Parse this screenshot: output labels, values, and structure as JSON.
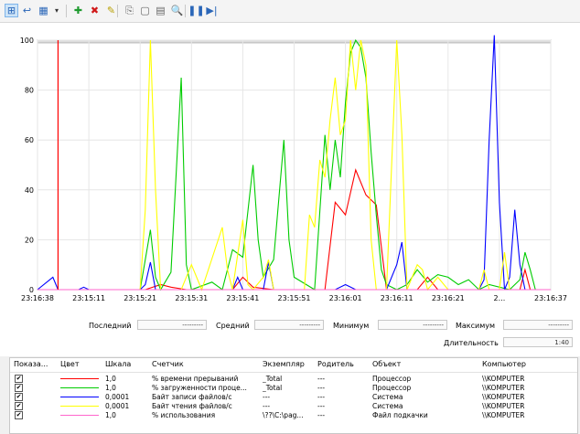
{
  "toolbar": {
    "buttons": [
      {
        "name": "view-graph-button",
        "glyph": "⊞"
      },
      {
        "name": "view-histogram-button",
        "glyph": "↩"
      },
      {
        "name": "change-graph-type-button",
        "glyph": "▦"
      },
      {
        "name": "graph-type-dropdown",
        "glyph": "▾"
      },
      {
        "name": "add-counter-button",
        "glyph": "✚"
      },
      {
        "name": "delete-counter-button",
        "glyph": "✖"
      },
      {
        "name": "highlight-button",
        "glyph": "✎"
      },
      {
        "name": "copy-properties-button",
        "glyph": "⎘"
      },
      {
        "name": "paste-counter-list-button",
        "glyph": "▢"
      },
      {
        "name": "properties-button",
        "glyph": "▤"
      },
      {
        "name": "zoom-button",
        "glyph": "🔍"
      },
      {
        "name": "freeze-display-button",
        "glyph": "❚❚"
      },
      {
        "name": "update-data-button",
        "glyph": "▶|"
      }
    ]
  },
  "chart_data": {
    "type": "line",
    "ylim": [
      0,
      100
    ],
    "yticks": [
      "0",
      "20",
      "40",
      "60",
      "80",
      "100"
    ],
    "xticks": [
      "23:16:38",
      "23:15:11",
      "23:15:21",
      "23:15:31",
      "23:15:41",
      "23:15:51",
      "23:16:01",
      "23:16:11",
      "23:16:21",
      "2...",
      "23:16:37"
    ],
    "current_time_marker": 4,
    "grid": true,
    "series": [
      {
        "color": "#ff0000",
        "points": [
          [
            0,
            0
          ],
          [
            4.5,
            0
          ],
          [
            5,
            0
          ],
          [
            21,
            0
          ],
          [
            24,
            2
          ],
          [
            26,
            1
          ],
          [
            29,
            0
          ],
          [
            38,
            0
          ],
          [
            40,
            5
          ],
          [
            42,
            1
          ],
          [
            46,
            0
          ],
          [
            56,
            0
          ],
          [
            58,
            35
          ],
          [
            60,
            30
          ],
          [
            62,
            48
          ],
          [
            64,
            38
          ],
          [
            66,
            34
          ],
          [
            68,
            0
          ],
          [
            72,
            0
          ],
          [
            74,
            0
          ],
          [
            76,
            5
          ],
          [
            78,
            0
          ],
          [
            94,
            0
          ],
          [
            95,
            8
          ],
          [
            96,
            0
          ],
          [
            100,
            0
          ]
        ]
      },
      {
        "color": "#00cc00",
        "points": [
          [
            0,
            0
          ],
          [
            20,
            0
          ],
          [
            22,
            24
          ],
          [
            23,
            5
          ],
          [
            24,
            0
          ],
          [
            26,
            7
          ],
          [
            28,
            85
          ],
          [
            29,
            10
          ],
          [
            30,
            0
          ],
          [
            34,
            3
          ],
          [
            36,
            0
          ],
          [
            38,
            16
          ],
          [
            40,
            13
          ],
          [
            42,
            50
          ],
          [
            43,
            20
          ],
          [
            44,
            5
          ],
          [
            46,
            12
          ],
          [
            48,
            60
          ],
          [
            49,
            20
          ],
          [
            50,
            5
          ],
          [
            54,
            0
          ],
          [
            56,
            62
          ],
          [
            57,
            40
          ],
          [
            58,
            60
          ],
          [
            59,
            45
          ],
          [
            60,
            75
          ],
          [
            61,
            95
          ],
          [
            62,
            100
          ],
          [
            63,
            97
          ],
          [
            64,
            85
          ],
          [
            65,
            55
          ],
          [
            66,
            30
          ],
          [
            67,
            8
          ],
          [
            68,
            2
          ],
          [
            70,
            0
          ],
          [
            72,
            2
          ],
          [
            74,
            8
          ],
          [
            76,
            3
          ],
          [
            78,
            6
          ],
          [
            80,
            5
          ],
          [
            82,
            2
          ],
          [
            84,
            4
          ],
          [
            86,
            0
          ],
          [
            88,
            2
          ],
          [
            92,
            0
          ],
          [
            94,
            4
          ],
          [
            95,
            15
          ],
          [
            96,
            8
          ],
          [
            97,
            0
          ],
          [
            100,
            0
          ]
        ]
      },
      {
        "color": "#0000ff",
        "points": [
          [
            0,
            0
          ],
          [
            3,
            5
          ],
          [
            4,
            0
          ],
          [
            8,
            0
          ],
          [
            9,
            1
          ],
          [
            10,
            0
          ],
          [
            20,
            0
          ],
          [
            21,
            2
          ],
          [
            22,
            11
          ],
          [
            23,
            0
          ],
          [
            38,
            0
          ],
          [
            39,
            5
          ],
          [
            40,
            0
          ],
          [
            44,
            0
          ],
          [
            45,
            11
          ],
          [
            46,
            0
          ],
          [
            58,
            0
          ],
          [
            60,
            2
          ],
          [
            62,
            0
          ],
          [
            68,
            0
          ],
          [
            70,
            10
          ],
          [
            71,
            19
          ],
          [
            72,
            0
          ],
          [
            86,
            0
          ],
          [
            87,
            4
          ],
          [
            88,
            60
          ],
          [
            89,
            102
          ],
          [
            90,
            35
          ],
          [
            91,
            0
          ],
          [
            92,
            5
          ],
          [
            93,
            32
          ],
          [
            94,
            10
          ],
          [
            95,
            0
          ],
          [
            100,
            0
          ]
        ]
      },
      {
        "color": "#ffff00",
        "points": [
          [
            0,
            0
          ],
          [
            20,
            0
          ],
          [
            21,
            32
          ],
          [
            22,
            100
          ],
          [
            23,
            40
          ],
          [
            24,
            0
          ],
          [
            28,
            0
          ],
          [
            30,
            10
          ],
          [
            32,
            0
          ],
          [
            36,
            25
          ],
          [
            37,
            8
          ],
          [
            38,
            0
          ],
          [
            40,
            28
          ],
          [
            41,
            2
          ],
          [
            42,
            0
          ],
          [
            44,
            5
          ],
          [
            45,
            12
          ],
          [
            46,
            0
          ],
          [
            52,
            0
          ],
          [
            53,
            30
          ],
          [
            54,
            25
          ],
          [
            55,
            52
          ],
          [
            56,
            45
          ],
          [
            57,
            68
          ],
          [
            58,
            85
          ],
          [
            59,
            62
          ],
          [
            60,
            68
          ],
          [
            61,
            100
          ],
          [
            62,
            80
          ],
          [
            63,
            100
          ],
          [
            64,
            90
          ],
          [
            65,
            20
          ],
          [
            66,
            0
          ],
          [
            68,
            0
          ],
          [
            70,
            100
          ],
          [
            71,
            62
          ],
          [
            72,
            0
          ],
          [
            74,
            10
          ],
          [
            75,
            8
          ],
          [
            76,
            0
          ],
          [
            78,
            5
          ],
          [
            80,
            0
          ],
          [
            86,
            0
          ],
          [
            87,
            8
          ],
          [
            88,
            0
          ],
          [
            90,
            0
          ],
          [
            91,
            15
          ],
          [
            92,
            0
          ],
          [
            100,
            0
          ]
        ]
      },
      {
        "color": "#ff66cc",
        "points": [
          [
            0,
            0
          ],
          [
            100,
            0
          ]
        ]
      }
    ]
  },
  "stats": {
    "last_label": "Последний",
    "last_value": "---------",
    "average_label": "Средний",
    "average_value": "---------",
    "minimum_label": "Минимум",
    "minimum_value": "---------",
    "maximum_label": "Максимум",
    "maximum_value": "---------",
    "duration_label": "Длительность",
    "duration_value": "1:40"
  },
  "table": {
    "headers": [
      "Показа...",
      "Цвет",
      "Шкала",
      "Счетчик",
      "Экземпляр",
      "Родитель",
      "Объект",
      "Компьютер"
    ],
    "rows": [
      {
        "checked": "✔",
        "color": "#ff0000",
        "scale": "1,0",
        "counter": "% времени прерываний",
        "instance": "_Total",
        "parent": "---",
        "object": "Процессор",
        "computer": "\\\\KOMPUTER"
      },
      {
        "checked": "✔",
        "color": "#00cc00",
        "scale": "1,0",
        "counter": "% загруженности проце...",
        "instance": "_Total",
        "parent": "---",
        "object": "Процессор",
        "computer": "\\\\KOMPUTER"
      },
      {
        "checked": "✔",
        "color": "#0000ff",
        "scale": "0,0001",
        "counter": "Байт записи файлов/с",
        "instance": "---",
        "parent": "---",
        "object": "Система",
        "computer": "\\\\KOMPUTER"
      },
      {
        "checked": "✔",
        "color": "#ffff00",
        "scale": "0,0001",
        "counter": "Байт чтения файлов/с",
        "instance": "---",
        "parent": "---",
        "object": "Система",
        "computer": "\\\\KOMPUTER"
      },
      {
        "checked": "✔",
        "color": "#ff66cc",
        "scale": "1,0",
        "counter": "% использования",
        "instance": "\\??\\C:\\pag...",
        "parent": "---",
        "object": "Файл подкачки",
        "computer": "\\\\KOMPUTER"
      }
    ]
  }
}
